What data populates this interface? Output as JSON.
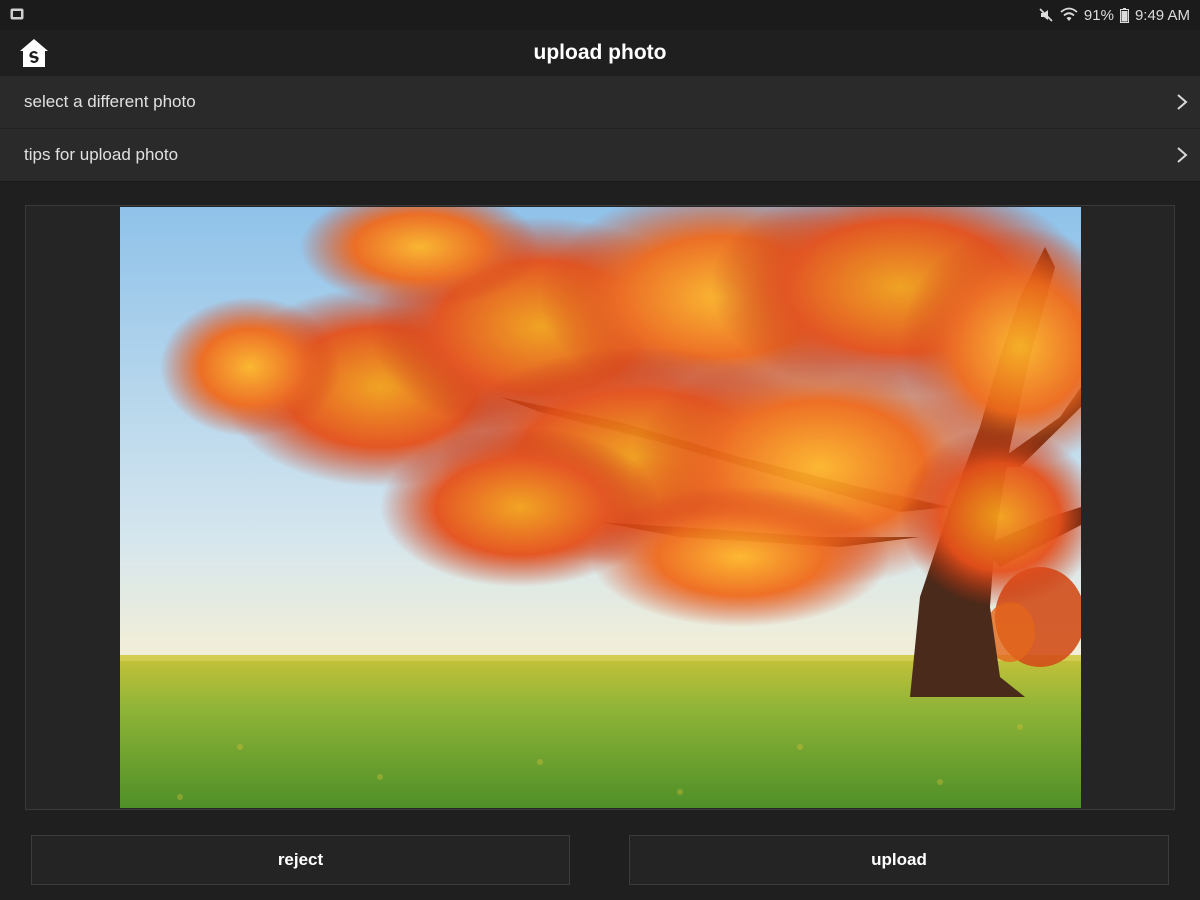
{
  "status_bar": {
    "battery": "91%",
    "time": "9:49 AM",
    "icons": [
      "notification-icon",
      "mute-icon",
      "wifi-icon",
      "battery-icon"
    ]
  },
  "app_bar": {
    "title": "upload photo",
    "home_icon": "home-icon"
  },
  "menu": {
    "items": [
      {
        "label": "select a different photo",
        "icon": "chevron-right-icon"
      },
      {
        "label": "tips for upload photo",
        "icon": "chevron-right-icon"
      }
    ]
  },
  "photo": {
    "subject": "autumn-tree-in-field"
  },
  "actions": {
    "reject_label": "reject",
    "upload_label": "upload"
  },
  "colors": {
    "background": "#1f1f1f",
    "row": "#2a2a2a",
    "button": "#242424",
    "text": "#ffffff"
  }
}
